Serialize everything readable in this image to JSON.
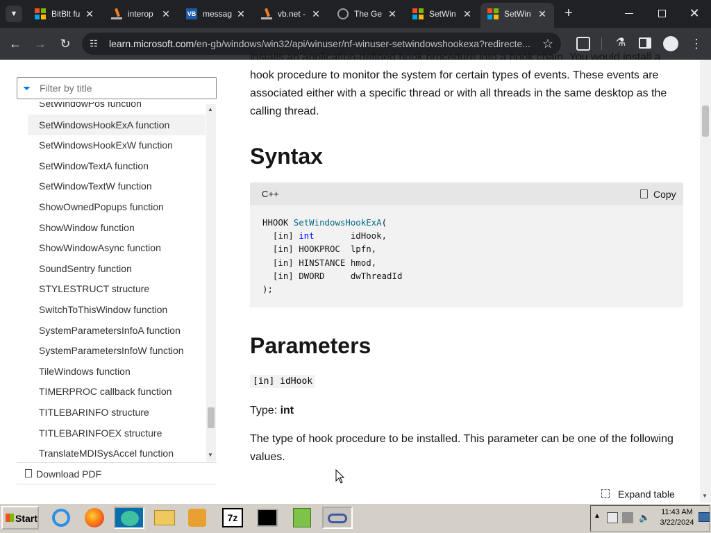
{
  "browser": {
    "tabs": [
      {
        "title": "BitBlt fu",
        "close": "✕"
      },
      {
        "title": "interop",
        "close": "✕"
      },
      {
        "title": "messag",
        "close": "✕"
      },
      {
        "title": "vb.net -",
        "close": "✕"
      },
      {
        "title": "The Ge",
        "close": "✕"
      },
      {
        "title": "SetWin",
        "close": "✕"
      },
      {
        "title": "SetWin",
        "close": "✕",
        "active": true
      }
    ],
    "new_tab": "+",
    "url_host": "learn.microsoft.com",
    "url_path": "/en-gb/windows/win32/api/winuser/nf-winuser-setwindowshookexa?redirecte...",
    "colors": {
      "tabbar": "#202124",
      "toolbar": "#35363a"
    }
  },
  "sidebar": {
    "filter_placeholder": "Filter by title",
    "toc": [
      "SetWindowPos function",
      "SetWindowsHookExA function",
      "SetWindowsHookExW function",
      "SetWindowTextA function",
      "SetWindowTextW function",
      "ShowOwnedPopups function",
      "ShowWindow function",
      "ShowWindowAsync function",
      "SoundSentry function",
      "STYLESTRUCT structure",
      "SwitchToThisWindow function",
      "SystemParametersInfoA function",
      "SystemParametersInfoW function",
      "TileWindows function",
      "TIMERPROC callback function",
      "TITLEBARINFO structure",
      "TITLEBARINFOEX structure",
      "TranslateMDISysAccel function"
    ],
    "selected_index": 1,
    "download_pdf": "Download PDF"
  },
  "content": {
    "intro_line1": "installs an application-defined hook procedure into a hook chain. You would install a",
    "intro_line2": "hook procedure to monitor the system for certain types of events. These events are",
    "intro_line3": "associated either with a specific thread or with all threads in the same desktop as the",
    "intro_line4": "calling thread.",
    "syntax_heading": "Syntax",
    "code_lang": "C++",
    "copy_label": "Copy",
    "code": {
      "line1_type": "HHOOK",
      "line1_fn": "SetWindowsHookExA",
      "line1_paren": "(",
      "line2_in": "  [in] ",
      "line2_type": "int",
      "line2_name": "       idHook,",
      "line3": "  [in] HOOKPROC  lpfn,",
      "line4": "  [in] HINSTANCE hmod,",
      "line5": "  [in] DWORD     dwThreadId",
      "line6": ");"
    },
    "parameters_heading": "Parameters",
    "param_name": "[in] idHook",
    "type_label": "Type: ",
    "type_value": "int",
    "desc_line1": "The type of hook procedure to be installed. This parameter can be one of the following",
    "desc_line2": "values.",
    "expand_table": "Expand table"
  },
  "taskbar": {
    "start_label": "Start",
    "clock_time": "11:43 AM",
    "clock_date": "3/22/2024",
    "icons": [
      "internet-explorer-icon",
      "firefox-icon",
      "chat-bubble-icon",
      "folder-icon",
      "media-player-icon",
      "7zip-icon",
      "command-prompt-icon",
      "notepad-plus-plus-icon",
      "infinity-app-icon"
    ]
  }
}
